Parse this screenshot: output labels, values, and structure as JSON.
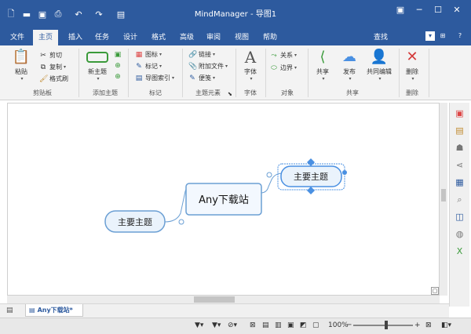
{
  "app": {
    "title": "MindManager - 导图1"
  },
  "ribbon_tabs": [
    {
      "label": "文件"
    },
    {
      "label": "主页"
    },
    {
      "label": "插入"
    },
    {
      "label": "任务"
    },
    {
      "label": "设计"
    },
    {
      "label": "格式"
    },
    {
      "label": "高级"
    },
    {
      "label": "审阅"
    },
    {
      "label": "视图"
    },
    {
      "label": "帮助"
    }
  ],
  "active_tab": "主页",
  "search_label": "查找",
  "ribbon": {
    "clipboard": {
      "paste": "粘贴",
      "cut": "剪切",
      "copy": "复制",
      "format_painter": "格式刷",
      "group": "剪贴板"
    },
    "add_topic": {
      "new_topic": "新主题",
      "group": "添加主题"
    },
    "markers": {
      "icon": "图标",
      "tag": "标记",
      "index": "导图索引",
      "group": "标记"
    },
    "topic_elements": {
      "link": "链接",
      "attach": "附加文件",
      "note": "便笺",
      "group": "主题元素"
    },
    "font": {
      "font": "字体",
      "group": "字体"
    },
    "objects": {
      "relation": "关系",
      "boundary": "边界",
      "group": "对象"
    },
    "share": {
      "share": "共享",
      "publish": "发布",
      "co_edit": "共同编辑",
      "group": "共享"
    },
    "delete": {
      "delete": "删除",
      "group": "删除"
    }
  },
  "map": {
    "central": "Any下载站",
    "left_topic": "主要主题",
    "right_topic": "主要主题"
  },
  "document_tab": "Any下载站*",
  "status": {
    "zoom": "100%"
  },
  "colors": {
    "brand": "#2d5a9e",
    "node_border": "#6b9fd4",
    "node_fill": "#eaf3fc",
    "selected": "#4a90e2"
  }
}
